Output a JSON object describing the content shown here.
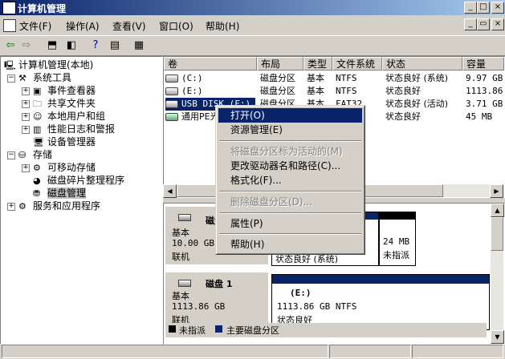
{
  "window": {
    "title": "计算机管理"
  },
  "menu": [
    "文件(F)",
    "操作(A)",
    "查看(V)",
    "窗口(O)",
    "帮助(H)"
  ],
  "tree": {
    "root": "计算机管理(本地)",
    "system_tools": "系统工具",
    "event_viewer": "事件查看器",
    "shared_folders": "共享文件夹",
    "local_users": "本地用户和组",
    "perf_logs": "性能日志和警报",
    "device_manager": "设备管理器",
    "storage": "存储",
    "removable": "可移动存储",
    "defrag": "磁盘碎片整理程序",
    "disk_mgmt": "磁盘管理",
    "services": "服务和应用程序"
  },
  "columns": [
    "卷",
    "布局",
    "类型",
    "文件系统",
    "状态",
    "容量"
  ],
  "volumes": [
    {
      "name": "(C:)",
      "layout": "磁盘分区",
      "type": "基本",
      "fs": "NTFS",
      "status": "状态良好 (系统)",
      "capacity": "9.97 GB"
    },
    {
      "name": "(E:)",
      "layout": "磁盘分区",
      "type": "基本",
      "fs": "NTFS",
      "status": "状态良好",
      "capacity": "1113.86"
    },
    {
      "name": "USB DISK (F:)",
      "layout": "磁盘分区",
      "type": "基本",
      "fs": "FAT32",
      "status": "状态良好 (活动)",
      "capacity": "3.71 GB"
    },
    {
      "name": "通用PE光盘",
      "layout": "",
      "type": "",
      "fs": "",
      "status": "状态良好",
      "capacity": "45 MB"
    }
  ],
  "disk0": {
    "title": "磁盘 0",
    "type": "基本",
    "size": "10.00 GB",
    "state": "联机",
    "part_status": "状态良好 (系统)",
    "unalloc_size": "24 MB",
    "unalloc_label": "未指派"
  },
  "disk1": {
    "title": "磁盘 1",
    "type": "基本",
    "size": "1113.86 GB",
    "state": "联机",
    "part_name": "(E:)",
    "part_size": "1113.86 GB NTFS",
    "part_status": "状态良好"
  },
  "legend": {
    "unallocated": "未指派",
    "primary": "主要磁盘分区"
  },
  "context_menu": [
    {
      "label": "打开(O)",
      "state": "highlighted"
    },
    {
      "label": "资源管理(E)",
      "state": "normal"
    },
    {
      "label": "将磁盘分区标为活动的(M)",
      "state": "disabled"
    },
    {
      "label": "更改驱动器名和路径(C)...",
      "state": "normal"
    },
    {
      "label": "格式化(F)...",
      "state": "normal"
    },
    {
      "label": "删除磁盘分区(D)...",
      "state": "disabled"
    },
    {
      "label": "属性(P)",
      "state": "normal"
    },
    {
      "label": "帮助(H)",
      "state": "normal"
    }
  ],
  "colors": {
    "title_active": "#0a246a",
    "highlight": "#0a246a",
    "primary_partition": "#0a246a",
    "unallocated": "#000000"
  }
}
